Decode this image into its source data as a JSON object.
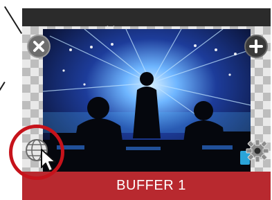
{
  "tile": {
    "label": "BUFFER 1",
    "footer_color": "#b8292f"
  },
  "icons": {
    "close": "close-icon",
    "add": "plus-icon",
    "web": "globe-icon",
    "settings": "gear-icon",
    "pointer": "mouse-pointer-icon"
  },
  "annotation": {
    "ring_color": "#c6131b"
  }
}
